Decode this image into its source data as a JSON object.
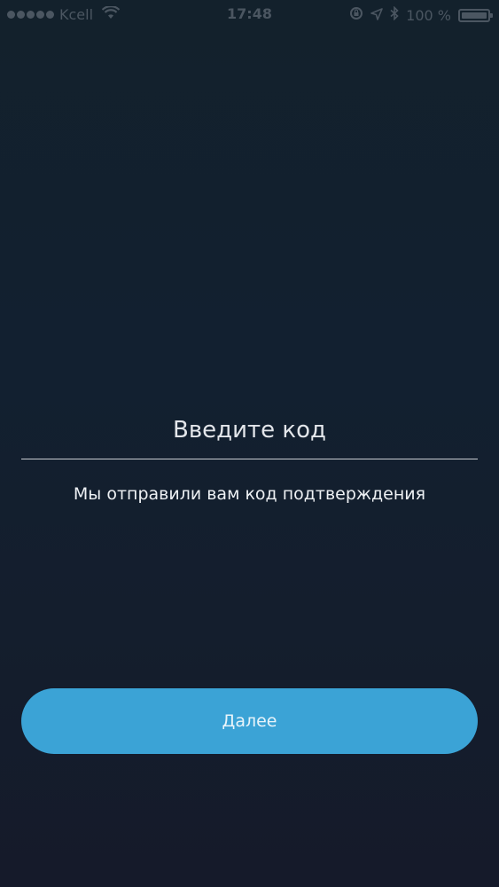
{
  "status_bar": {
    "carrier": "Kcell",
    "time": "17:48",
    "battery": "100 %",
    "battery_level": 1.0,
    "icons": [
      "signal-icon",
      "wifi-icon",
      "lock-rotation-icon",
      "location-icon",
      "bluetooth-icon",
      "battery-icon"
    ]
  },
  "code_field": {
    "placeholder": "Введите код",
    "value": ""
  },
  "subtitle": "Мы отправили вам код подтверждения",
  "next_button": {
    "label": "Далее",
    "color": "#3ba3d6"
  },
  "colors": {
    "background": "#13202d",
    "status_text": "#4b5661",
    "accent": "#3ba3d6"
  }
}
